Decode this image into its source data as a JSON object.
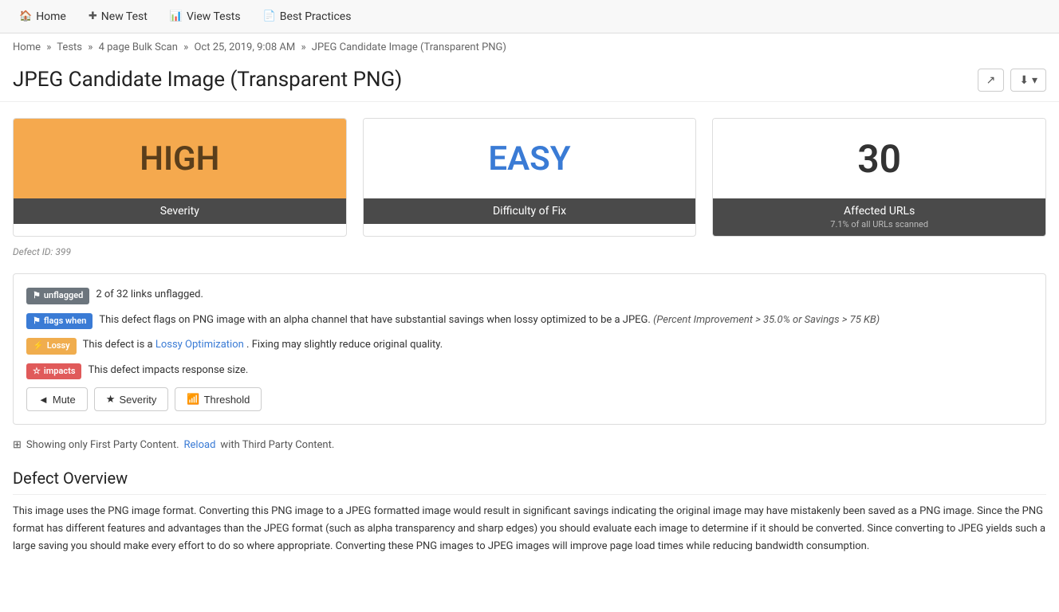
{
  "nav": {
    "home_label": "Home",
    "new_test_label": "New Test",
    "view_tests_label": "View Tests",
    "best_practices_label": "Best Practices"
  },
  "breadcrumb": {
    "home": "Home",
    "tests": "Tests",
    "scan": "4 page Bulk Scan",
    "date": "Oct 25, 2019, 9:08 AM",
    "current": "JPEG Candidate Image (Transparent PNG)"
  },
  "page": {
    "title": "JPEG Candidate Image (Transparent PNG)",
    "share_icon": "↗",
    "download_icon": "⬇"
  },
  "cards": {
    "severity_value": "HIGH",
    "severity_label": "Severity",
    "difficulty_value": "EASY",
    "difficulty_label": "Difficulty of Fix",
    "affected_value": "30",
    "affected_label": "Affected URLs",
    "affected_sub": "7.1% of all URLs scanned"
  },
  "defect_id": "Defect ID: 399",
  "info": {
    "unflagged_badge": "unflagged",
    "unflagged_text": "2 of 32 links unflagged.",
    "flags_badge": "flags when",
    "flags_text": "This defect flags on PNG image with an alpha channel that have substantial savings when lossy optimized to be a JPEG.",
    "flags_extra": "(Percent Improvement > 35.0% or Savings > 75 KB)",
    "lossy_badge": "Lossy",
    "lossy_text_before": "This defect is a",
    "lossy_link": "Lossy Optimization",
    "lossy_text_after": ". Fixing may slightly reduce original quality.",
    "impacts_badge": "impacts",
    "impacts_text": "This defect impacts response size.",
    "mute_label": "Mute",
    "severity_label": "Severity",
    "threshold_label": "Threshold"
  },
  "third_party": {
    "icon": "⊞",
    "text_before": "Showing only First Party Content.",
    "reload_label": "Reload",
    "text_after": "with Third Party Content."
  },
  "overview": {
    "heading": "Defect Overview",
    "body": "This image uses the PNG image format. Converting this PNG image to a JPEG formatted image would result in significant savings indicating the original image may have mistakenly been saved as a PNG image. Since the PNG format has different features and advantages than the JPEG format (such as alpha transparency and sharp edges) you should evaluate each image to determine if it should be converted. Since converting to JPEG yields such a large saving you should make every effort to do so where appropriate. Converting these PNG images to JPEG images will improve page load times while reducing bandwidth consumption."
  }
}
